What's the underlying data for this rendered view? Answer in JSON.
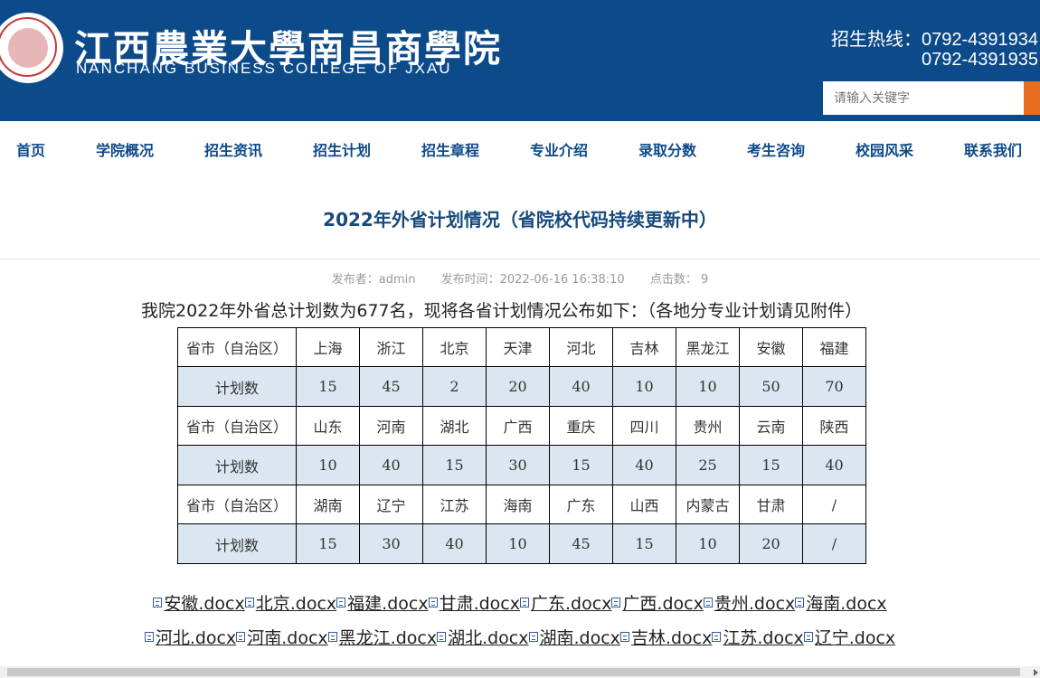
{
  "header": {
    "school_cn": "江西農業大學南昌商學院",
    "school_en": "NANCHANG BUSINESS COLLEGE OF JXAU",
    "hotline_label": "招生热线：",
    "hotline_1": "0792-4391934",
    "hotline_2": "0792-4391935",
    "search_placeholder": "请输入关键字",
    "brand_color": "#0d4a8a",
    "accent_color": "#e76c1f"
  },
  "nav": [
    "首页",
    "学院概况",
    "招生资讯",
    "招生计划",
    "招生章程",
    "专业介绍",
    "录取分数",
    "考生咨询",
    "校园风采",
    "联系我们"
  ],
  "article": {
    "title": "2022年外省计划情况（省院校代码持续更新中）",
    "author": "发布者：admin",
    "published": "发布时间：2022-06-16 16:38:10",
    "clicks": "点击数： 9",
    "lead": "我院2022年外省总计划数为677名，现将各省计划情况公布如下：（各地分专业计划请见附件）"
  },
  "plan_table": {
    "province_label": "省市（自治区）",
    "count_label": "计划数",
    "groups": [
      {
        "provinces": [
          "上海",
          "浙江",
          "北京",
          "天津",
          "河北",
          "吉林",
          "黑龙江",
          "安徽",
          "福建"
        ],
        "counts": [
          "15",
          "45",
          "2",
          "20",
          "40",
          "10",
          "10",
          "50",
          "70"
        ]
      },
      {
        "provinces": [
          "山东",
          "河南",
          "湖北",
          "广西",
          "重庆",
          "四川",
          "贵州",
          "云南",
          "陕西"
        ],
        "counts": [
          "10",
          "40",
          "15",
          "30",
          "15",
          "40",
          "25",
          "15",
          "40"
        ]
      },
      {
        "provinces": [
          "湖南",
          "辽宁",
          "江苏",
          "海南",
          "广东",
          "山西",
          "内蒙古",
          "甘肃",
          "/"
        ],
        "counts": [
          "15",
          "30",
          "40",
          "10",
          "45",
          "15",
          "10",
          "20",
          "/"
        ]
      }
    ]
  },
  "attachments": [
    [
      "安徽.docx",
      "北京.docx",
      "福建.docx",
      "甘肃.docx",
      "广东.docx",
      "广西.docx",
      "贵州.docx",
      "海南.docx"
    ],
    [
      "河北.docx",
      "河南.docx",
      "黑龙江.docx",
      "湖北.docx",
      "湖南.docx",
      "吉林.docx",
      "江苏.docx",
      "辽宁.docx"
    ]
  ]
}
